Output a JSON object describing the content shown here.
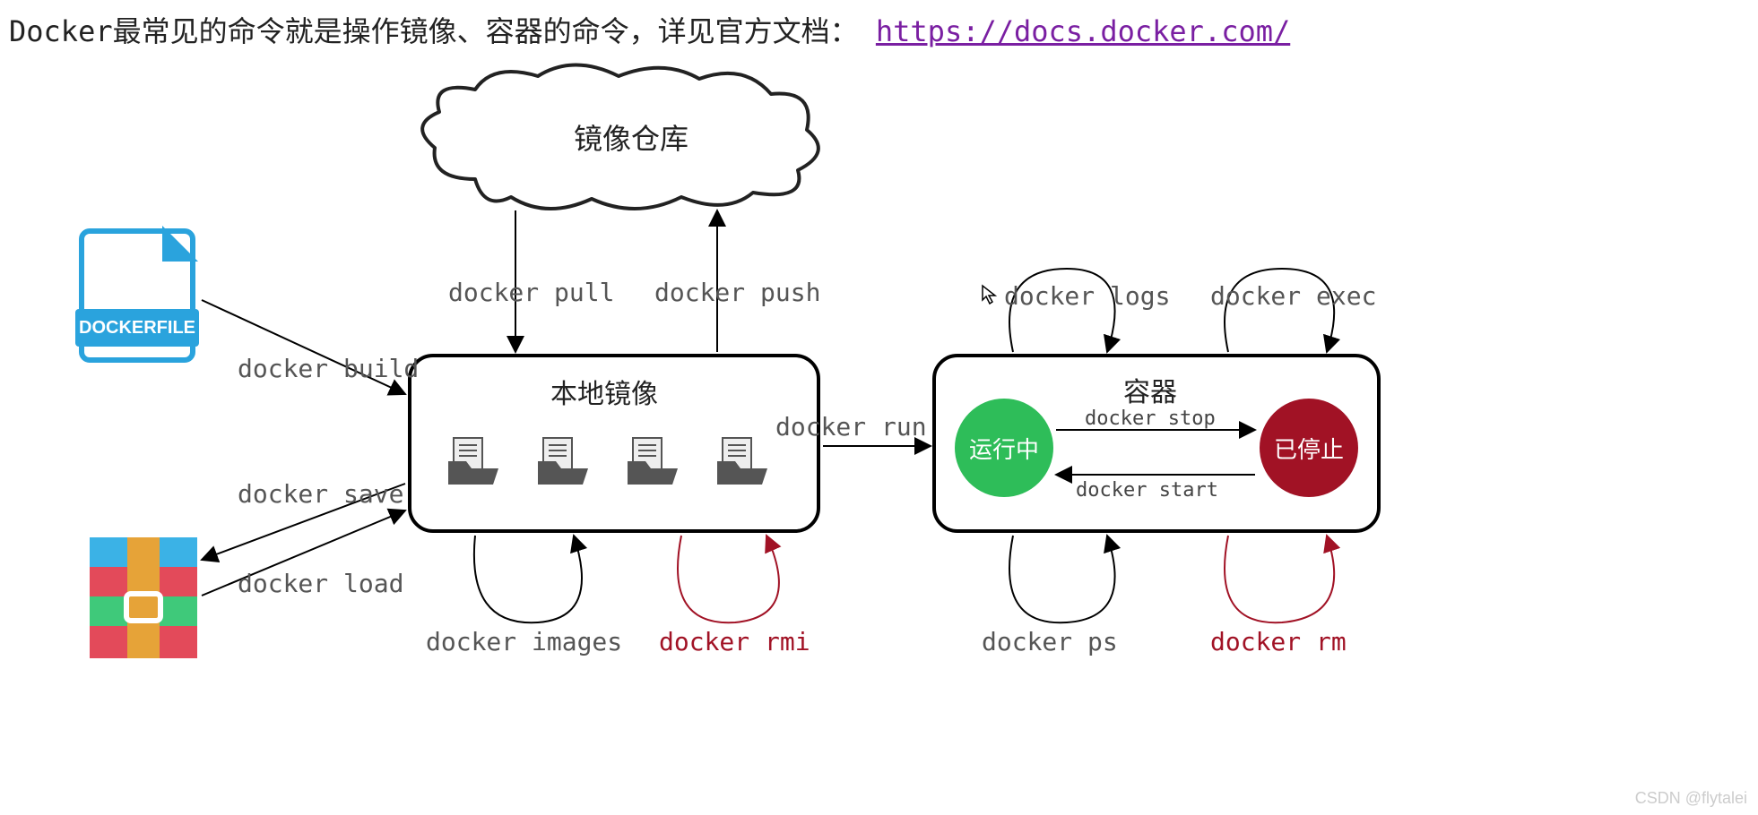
{
  "title_prefix": "Docker最常见的命令就是操作镜像、容器的命令，详见官方文档：",
  "docs_link": "https://docs.docker.com/",
  "cloud_label": "镜像仓库",
  "dockerfile_label": "DOCKERFILE",
  "local_images_label": "本地镜像",
  "container_label": "容器",
  "state_running": "运行中",
  "state_stopped": "已停止",
  "cmd_build": "docker build",
  "cmd_save": "docker save",
  "cmd_load": "docker load",
  "cmd_pull": "docker pull",
  "cmd_push": "docker push",
  "cmd_run": "docker run",
  "cmd_images": "docker images",
  "cmd_rmi": "docker rmi",
  "cmd_logs": "docker logs",
  "cmd_exec": "docker exec",
  "cmd_stop": "docker stop",
  "cmd_start": "docker start",
  "cmd_ps": "docker ps",
  "cmd_rm": "docker rm",
  "watermark": "CSDN @flytalei"
}
